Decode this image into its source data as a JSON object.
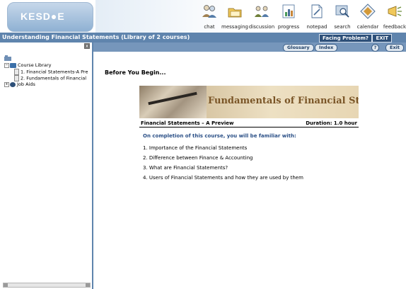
{
  "header": {
    "logo_text": "KESD●E",
    "tools": [
      {
        "label": "chat",
        "icon": "chat-icon"
      },
      {
        "label": "messaging",
        "icon": "messaging-icon"
      },
      {
        "label": "discussion",
        "icon": "discussion-icon"
      },
      {
        "label": "progress",
        "icon": "progress-icon"
      },
      {
        "label": "notepad",
        "icon": "notepad-icon"
      },
      {
        "label": "search",
        "icon": "search-icon"
      },
      {
        "label": "calendar",
        "icon": "calendar-icon"
      },
      {
        "label": "feedback",
        "icon": "feedback-icon"
      }
    ]
  },
  "titlebar": {
    "title": "Understanding Financial Statements (Library of 2 courses)",
    "facing_problem": "Facing Problem?",
    "exit": "EXIT"
  },
  "sidebar": {
    "close": "x",
    "tree": [
      {
        "label": "Course Library",
        "type": "folder",
        "toggle": "−"
      },
      {
        "label": "1. Financial Statements-A Pre",
        "type": "doc"
      },
      {
        "label": "2. Fundamentals of Financial",
        "type": "doc"
      },
      {
        "label": "Job Aids",
        "type": "folder",
        "toggle": "+"
      }
    ]
  },
  "nav": {
    "glossary": "Glossary",
    "index": "Index",
    "help": "?",
    "exit": "Exit"
  },
  "content": {
    "heading": "Before You Begin...",
    "banner_title": "Fundamentals of Financial Statements",
    "course_name": "Financial Statements – A Preview",
    "duration": "Duration: 1.0 hour",
    "completion_intro": "On completion of this course, you will be familiar with:",
    "points": [
      "1.  Importance of the Financial Statements",
      "2.  Difference between Finance & Accounting",
      "3.  What are Financial Statements?",
      "4.  Users of Financial Statements and how they are used by them"
    ]
  },
  "colors": {
    "title_bar": "#5f84ad",
    "nav_bar": "#7696bb",
    "accent_text": "#2a4f86",
    "banner_title": "#7a5527"
  }
}
